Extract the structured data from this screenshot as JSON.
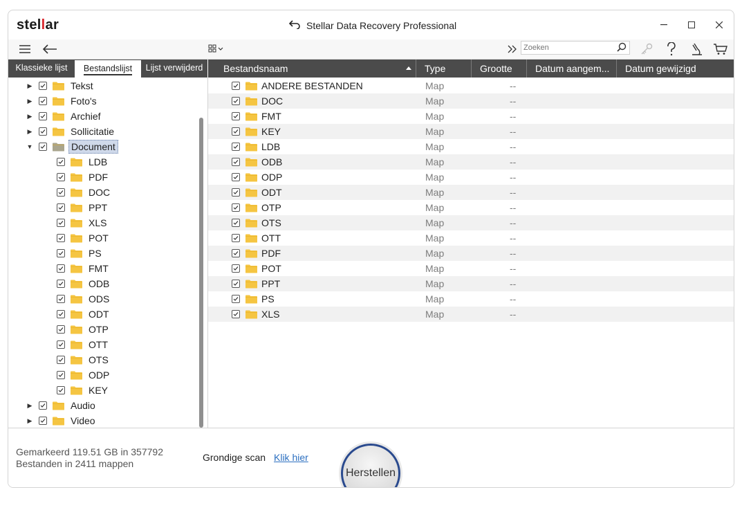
{
  "app": {
    "logo_pre": "stel",
    "logo_mid": "l",
    "logo_post": "ar",
    "title": "Stellar Data Recovery Professional"
  },
  "toolbar": {
    "search_placeholder": "Zoeken"
  },
  "left_tabs": [
    {
      "label": "Klassieke lijst",
      "active": false
    },
    {
      "label": "Bestandslijst",
      "active": true
    },
    {
      "label": "Lijst verwijderd",
      "active": false
    }
  ],
  "tree": {
    "top_items": [
      "Tekst",
      "Foto's",
      "Archief",
      "Sollicitatie"
    ],
    "expanded_item": "Document",
    "children": [
      "LDB",
      "PDF",
      "DOC",
      "PPT",
      "XLS",
      "POT",
      "PS",
      "FMT",
      "ODB",
      "ODS",
      "ODT",
      "OTP",
      "OTT",
      "OTS",
      "ODP",
      "KEY"
    ],
    "bottom_items": [
      "Audio",
      "Video"
    ]
  },
  "grid": {
    "columns": [
      "Bestandsnaam",
      "Type",
      "Grootte",
      "Datum aangem...",
      "Datum gewijzigd"
    ],
    "rows": [
      {
        "name": "ANDERE BESTANDEN",
        "type": "Map",
        "size": "--"
      },
      {
        "name": "DOC",
        "type": "Map",
        "size": "--"
      },
      {
        "name": "FMT",
        "type": "Map",
        "size": "--"
      },
      {
        "name": "KEY",
        "type": "Map",
        "size": "--"
      },
      {
        "name": "LDB",
        "type": "Map",
        "size": "--"
      },
      {
        "name": "ODB",
        "type": "Map",
        "size": "--"
      },
      {
        "name": "ODP",
        "type": "Map",
        "size": "--"
      },
      {
        "name": "ODT",
        "type": "Map",
        "size": "--"
      },
      {
        "name": "OTP",
        "type": "Map",
        "size": "--"
      },
      {
        "name": "OTS",
        "type": "Map",
        "size": "--"
      },
      {
        "name": "OTT",
        "type": "Map",
        "size": "--"
      },
      {
        "name": "PDF",
        "type": "Map",
        "size": "--"
      },
      {
        "name": "POT",
        "type": "Map",
        "size": "--"
      },
      {
        "name": "PPT",
        "type": "Map",
        "size": "--"
      },
      {
        "name": "PS",
        "type": "Map",
        "size": "--"
      },
      {
        "name": "XLS",
        "type": "Map",
        "size": "--"
      }
    ]
  },
  "status": {
    "line1": "Gemarkeerd 119.51 GB in 357792",
    "line2": "Bestanden in 2411 mappen",
    "deep_scan_label": "Grondige scan",
    "deep_scan_link": "Klik hier",
    "recover_label": "Herstellen"
  },
  "colors": {
    "header_bg": "#4b4b4b",
    "folder": "#f5c542",
    "document_folder": "#a9a58e",
    "link": "#2b6fc0",
    "accent_ring": "#2a4a8e",
    "logo_red": "#d8232a"
  }
}
